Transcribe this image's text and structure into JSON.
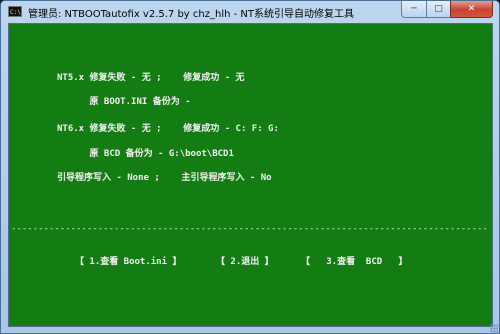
{
  "window": {
    "title": "管理员:  NTBOOTautofix v2.5.7 by chz_hlh - NT系统引导自动修复工具",
    "icon": "console-icon",
    "icon_label": "C:\\",
    "minimize_label": "─",
    "maximize_label": "□",
    "close_label": "✕"
  },
  "console": {
    "lines": [
      "NT5.x 修复失败 - 无 ;    修复成功 - 无",
      "      原 BOOT.INI 备份为 -",
      "NT6.x 修复失败 - 无 ;    修复成功 - C: F: G:",
      "      原 BCD 备份为 - G:\\boot\\BCD1",
      "引导程序写入 - None ;    主引导程序写入 - No"
    ],
    "divider": "------------------------------------------------------------------------------------------"
  },
  "menu": {
    "options": [
      "【 1.查看 Boot.ini 】",
      "【 2.退出 】",
      "【   3.查看  BCD   】"
    ]
  },
  "colors": {
    "console_bg": "#137d13",
    "console_fg": "#f2f2f2",
    "titlebar": "#bcd6ef",
    "close_button": "#c6442e"
  }
}
